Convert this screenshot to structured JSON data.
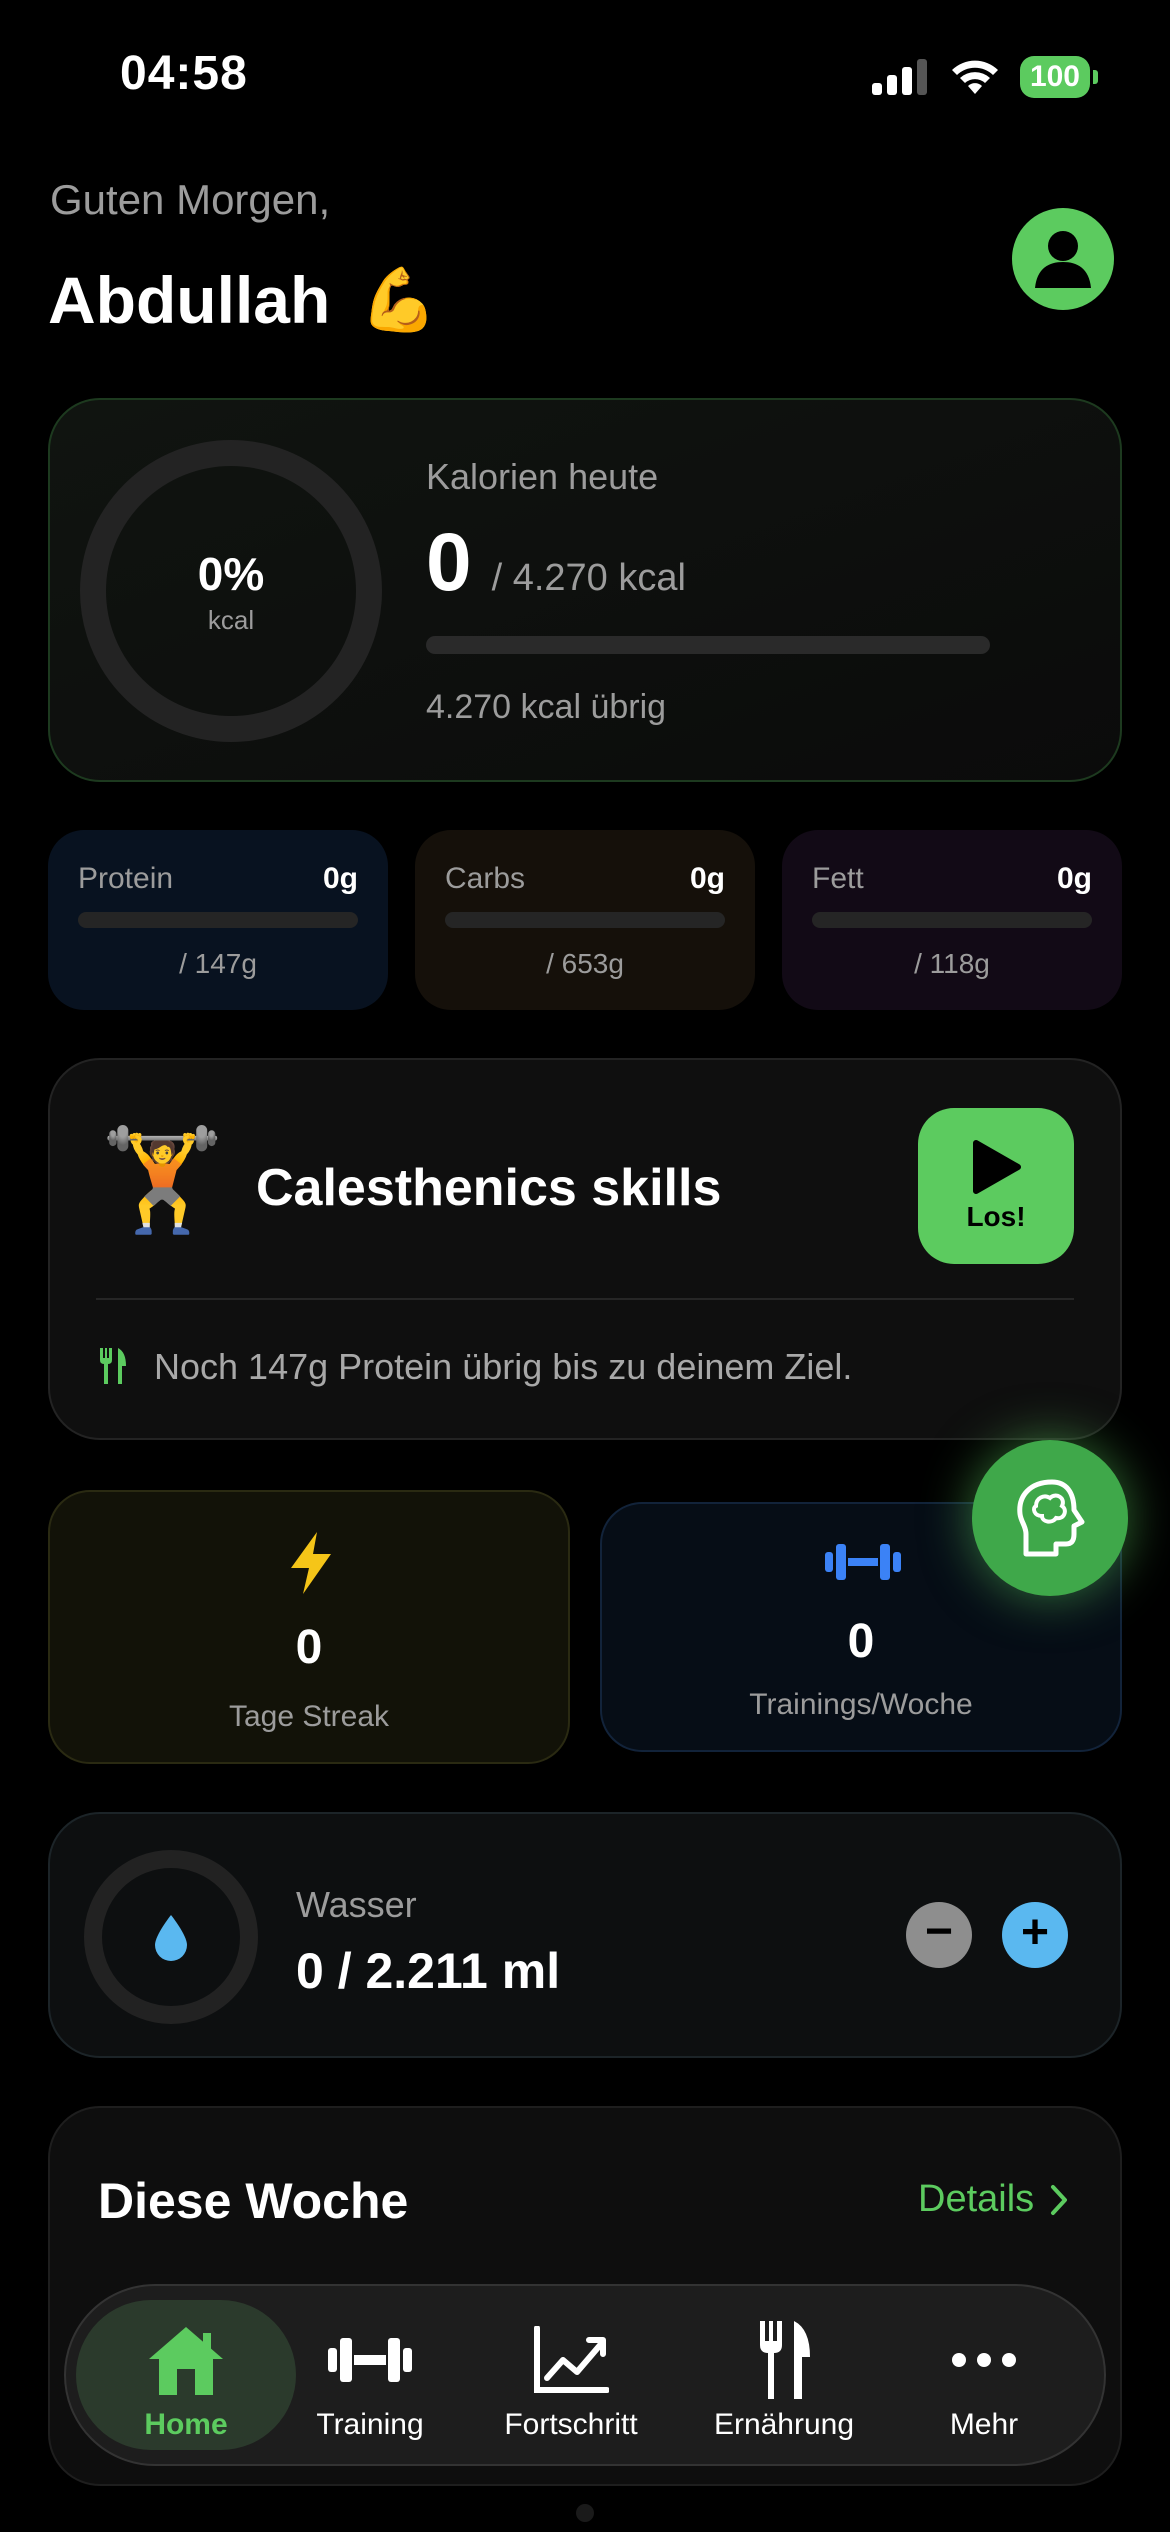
{
  "status": {
    "time": "04:58",
    "battery": "100"
  },
  "greeting": {
    "line1": "Guten Morgen,",
    "name": "Abdullah",
    "emoji": "💪"
  },
  "calories": {
    "percent": "0%",
    "ring_unit": "kcal",
    "label": "Kalorien heute",
    "consumed": "0",
    "goal": "/ 4.270 kcal",
    "remaining": "4.270 kcal übrig",
    "progress": 0
  },
  "macros": [
    {
      "label": "Protein",
      "value": "0g",
      "goal": "/ 147g",
      "color": "#0a1220"
    },
    {
      "label": "Carbs",
      "value": "0g",
      "goal": "/ 653g",
      "color": "#17120a"
    },
    {
      "label": "Fett",
      "value": "0g",
      "goal": "/ 118g",
      "color": "#140a18"
    }
  ],
  "workout": {
    "emoji": "🏋️",
    "title": "Calesthenics skills",
    "start_label": "Los!",
    "note": "Noch 147g Protein übrig bis zu deinem Ziel."
  },
  "stats": {
    "streak": {
      "value": "0",
      "label": "Tage Streak",
      "color": "#f5c518"
    },
    "trainings": {
      "value": "0",
      "label": "Trainings/Woche",
      "color": "#3b82f6"
    }
  },
  "water": {
    "label": "Wasser",
    "value": "0 / 2.211 ml",
    "minus": "−",
    "plus": "+",
    "accent": "#5ab8f0"
  },
  "week": {
    "title": "Diese Woche",
    "details_label": "Details"
  },
  "tabs": [
    {
      "label": "Home",
      "icon": "home-icon",
      "active": true
    },
    {
      "label": "Training",
      "icon": "dumbbell-icon",
      "active": false
    },
    {
      "label": "Fortschritt",
      "icon": "chart-icon",
      "active": false
    },
    {
      "label": "Ernährung",
      "icon": "utensils-icon",
      "active": false
    },
    {
      "label": "Mehr",
      "icon": "more-icon",
      "active": false
    }
  ],
  "colors": {
    "accent": "#5ccb5f",
    "background": "#000000",
    "muted": "#9c9c9c"
  }
}
